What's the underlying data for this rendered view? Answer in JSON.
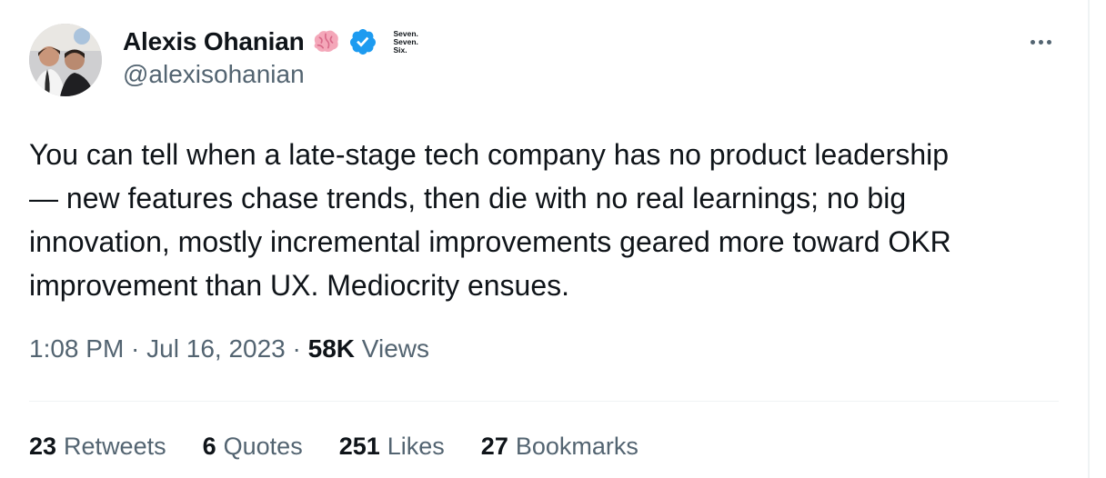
{
  "author": {
    "display_name": "Alexis Ohanian",
    "handle": "@alexisohanian",
    "avatar": "profile-photo",
    "emoji": "brain-icon",
    "verified": true,
    "affiliate_badge": [
      "Seven.",
      "Seven.",
      "Six."
    ]
  },
  "tweet": {
    "text": "You can tell when a late-stage tech company has no product leadership\n— new features chase trends, then die with no real learnings; no big\ninnovation, mostly incremental improvements geared more toward OKR\nimprovement than UX. Mediocrity ensues.",
    "time": "1:08 PM",
    "date": "Jul 16, 2023",
    "separator": " · ",
    "views_count": "58K",
    "views_label": "Views"
  },
  "stats": [
    {
      "count": "23",
      "label": "Retweets"
    },
    {
      "count": "6",
      "label": "Quotes"
    },
    {
      "count": "251",
      "label": "Likes"
    },
    {
      "count": "27",
      "label": "Bookmarks"
    }
  ],
  "colors": {
    "text": "#0f1419",
    "secondary": "#536471",
    "verified": "#1d9bf0",
    "divider": "#eff3f4",
    "brain": "#f4a7b9"
  }
}
